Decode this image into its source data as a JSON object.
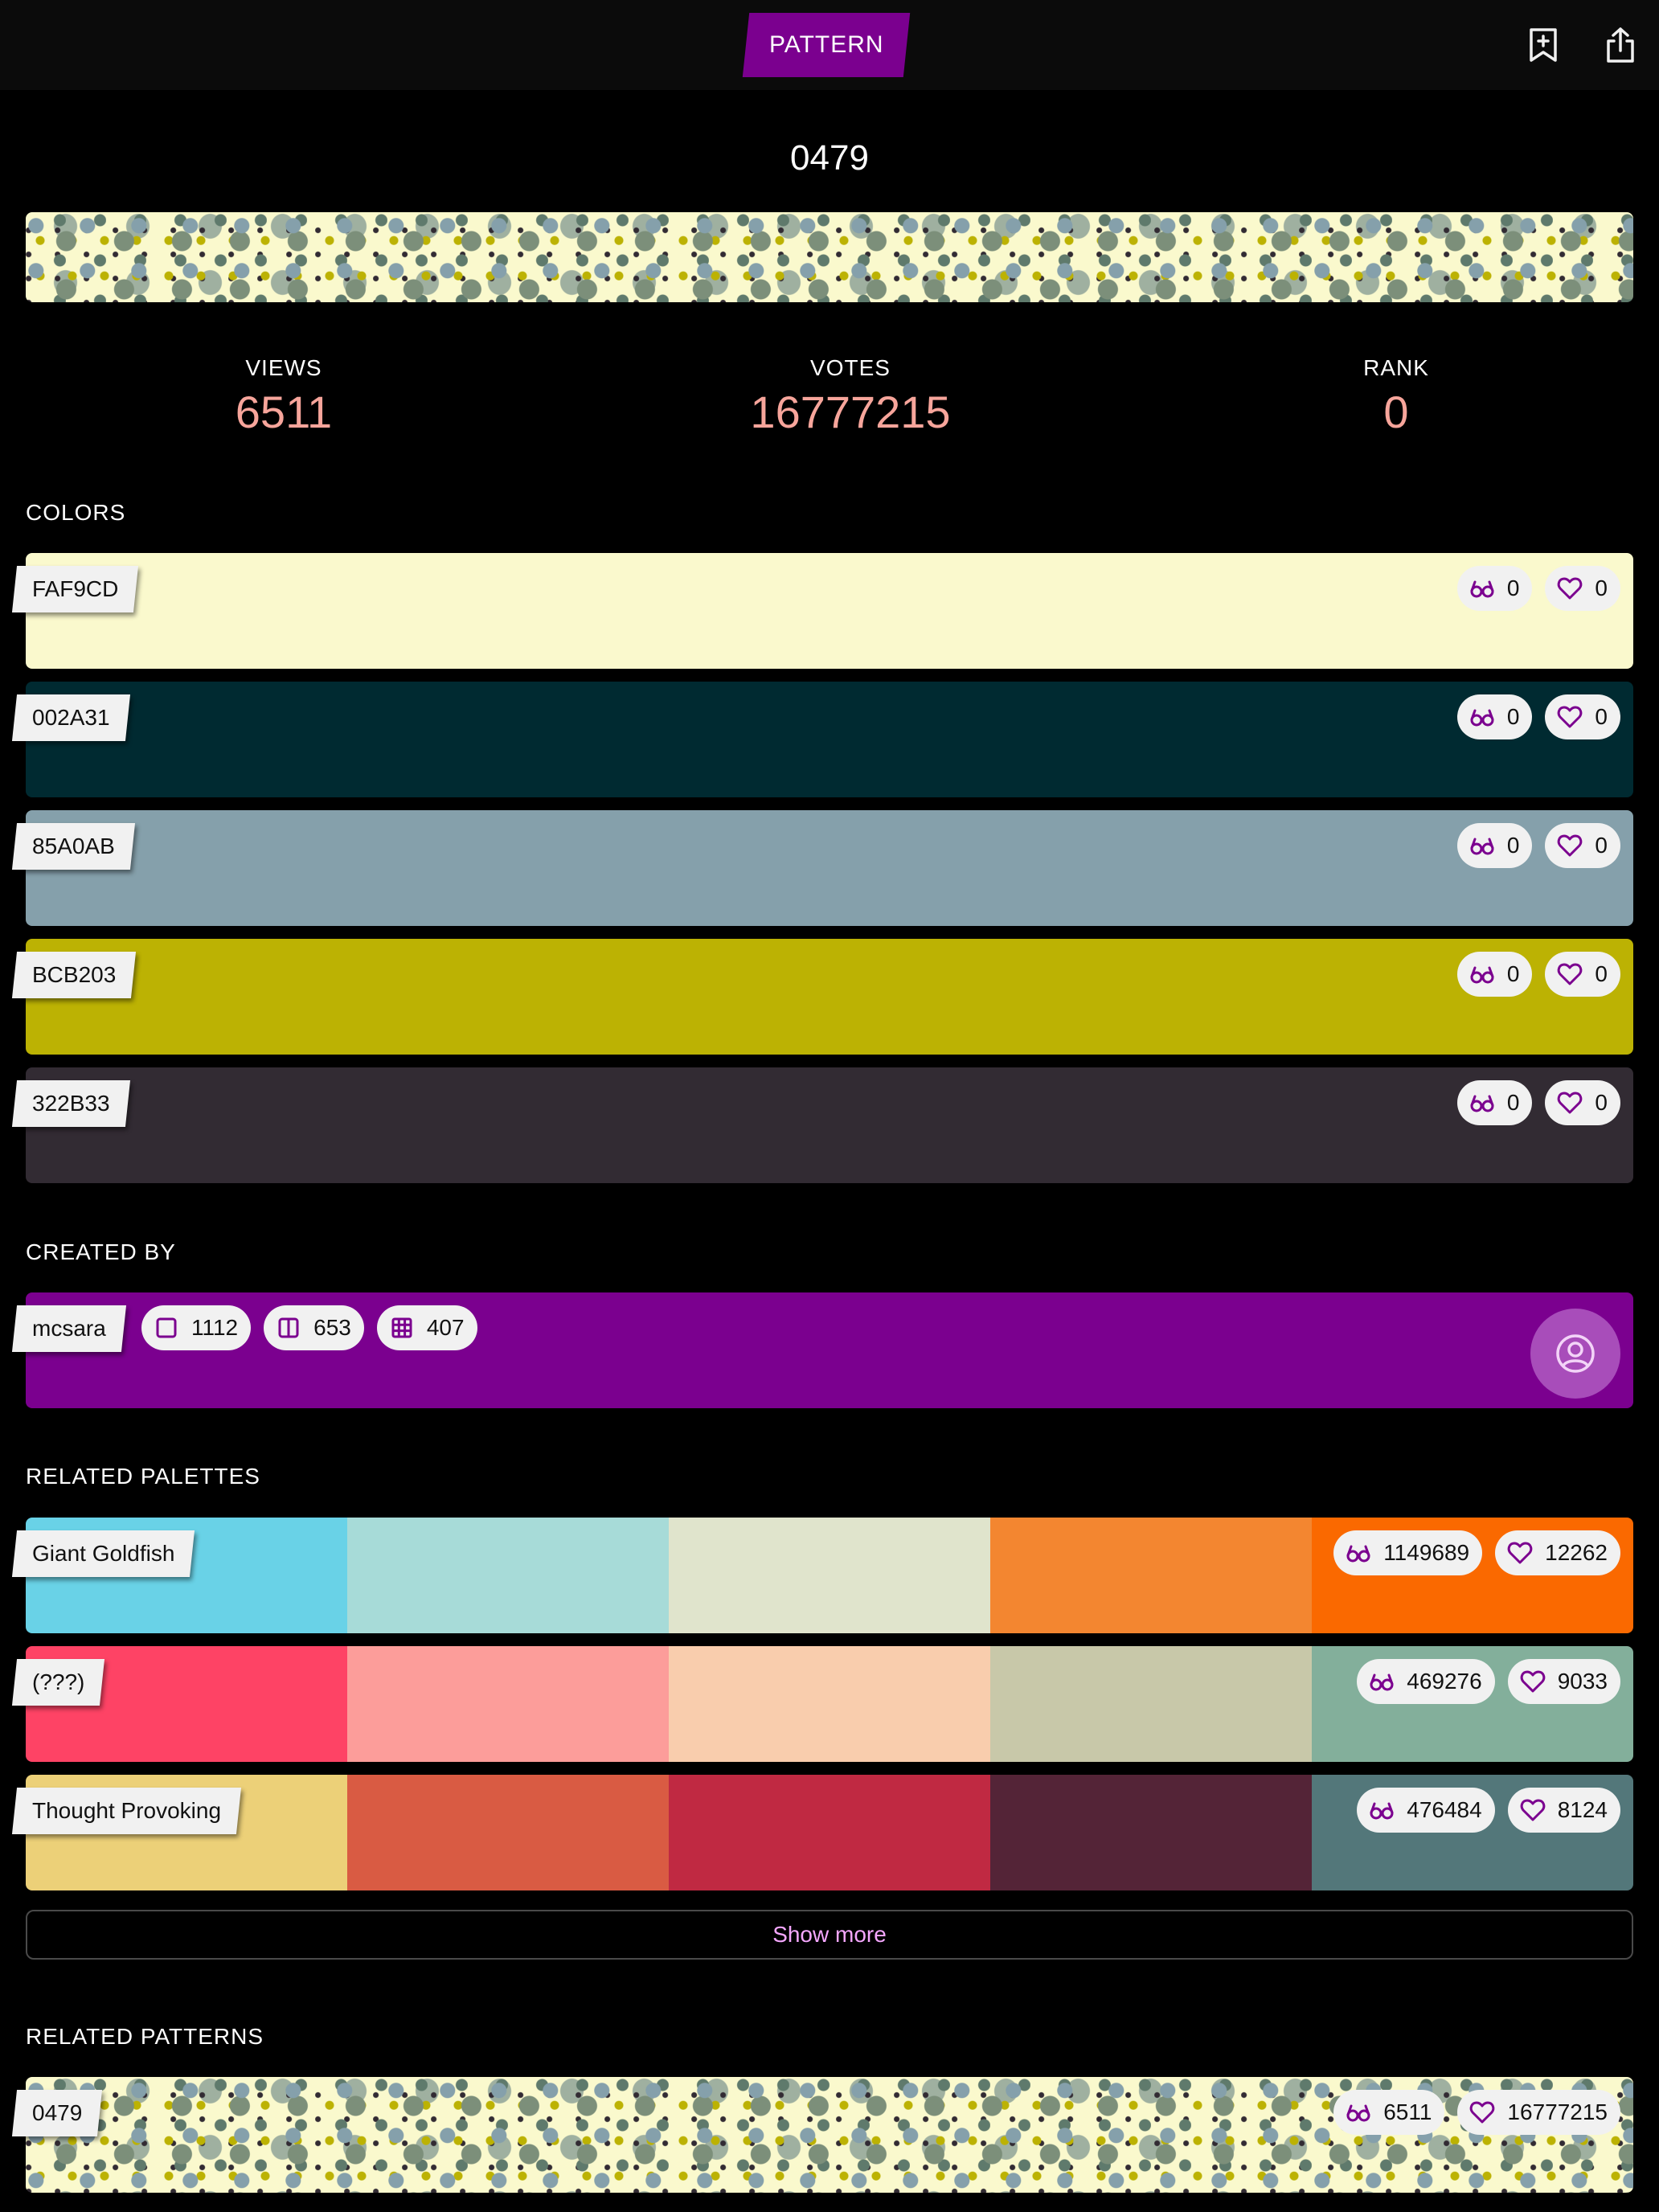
{
  "header": {
    "tab_label": "PATTERN",
    "bookmark_icon": "bookmark-add-icon",
    "share_icon": "share-icon"
  },
  "pattern": {
    "title": "0479"
  },
  "stats": [
    {
      "label": "VIEWS",
      "value": "6511"
    },
    {
      "label": "VOTES",
      "value": "16777215"
    },
    {
      "label": "RANK",
      "value": "0"
    }
  ],
  "colors": {
    "title": "COLORS",
    "items": [
      {
        "hex": "FAF9CD",
        "color": "#FAF9CD",
        "views": "0",
        "likes": "0"
      },
      {
        "hex": "002A31",
        "color": "#002A31",
        "views": "0",
        "likes": "0"
      },
      {
        "hex": "85A0AB",
        "color": "#85A0AB",
        "views": "0",
        "likes": "0"
      },
      {
        "hex": "BCB203",
        "color": "#BCB203",
        "views": "0",
        "likes": "0"
      },
      {
        "hex": "322B33",
        "color": "#322B33",
        "views": "0",
        "likes": "0"
      }
    ]
  },
  "creator": {
    "title": "CREATED BY",
    "name": "mcsara",
    "colors_count": "1112",
    "palettes_count": "653",
    "patterns_count": "407",
    "color": "#7B008F"
  },
  "related_palettes": {
    "title": "RELATED PALETTES",
    "items": [
      {
        "name": "Giant Goldfish",
        "views": "1149689",
        "likes": "12262",
        "colors": [
          "#69D2E7",
          "#A7DBD8",
          "#E0E4CC",
          "#F38630",
          "#FA6900"
        ]
      },
      {
        "name": "(???)",
        "views": "469276",
        "likes": "9033",
        "colors": [
          "#FE4365",
          "#FC9D9A",
          "#F9CDAD",
          "#C8C8A9",
          "#83AF9B"
        ]
      },
      {
        "name": "Thought Provoking",
        "views": "476484",
        "likes": "8124",
        "colors": [
          "#ECD078",
          "#D95B43",
          "#C02942",
          "#542437",
          "#53777A"
        ]
      }
    ],
    "show_more": "Show more"
  },
  "related_patterns": {
    "title": "RELATED PATTERNS",
    "items": [
      {
        "name": "0479",
        "views": "6511",
        "likes": "16777215"
      }
    ]
  },
  "accent": "#7B008F",
  "stat_value_color": "#F7A59B"
}
